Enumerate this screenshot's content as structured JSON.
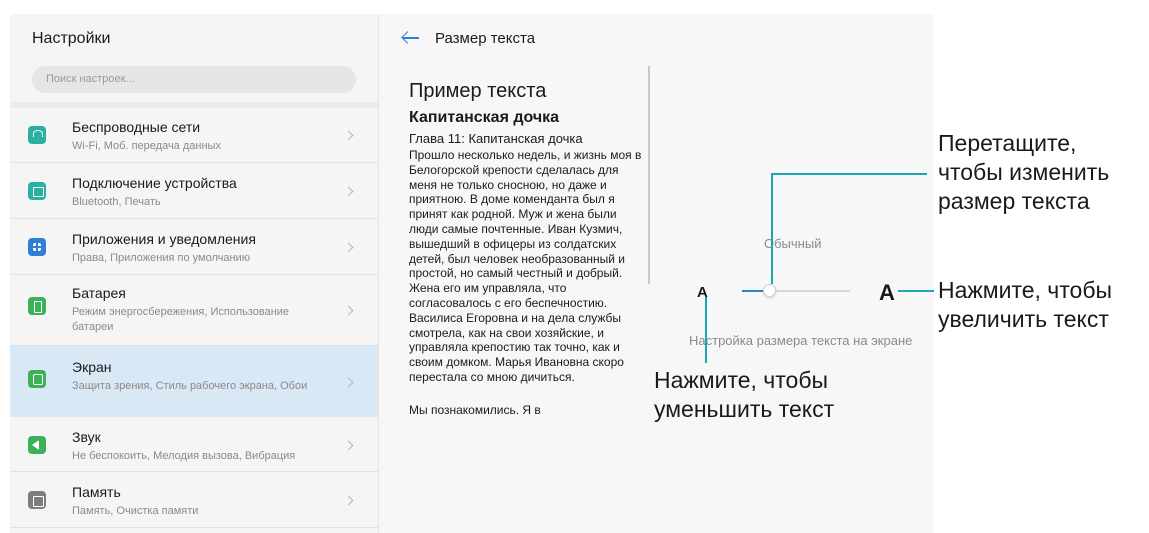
{
  "settings": {
    "title": "Настройки",
    "search_placeholder": "Поиск настроек...",
    "items": [
      {
        "title": "Беспроводные сети",
        "subtitle": "Wi-Fi, Моб. передача данных",
        "icon": "wifi-icon"
      },
      {
        "title": "Подключение устройства",
        "subtitle": "Bluetooth, Печать",
        "icon": "device-connection-icon"
      },
      {
        "title": "Приложения и уведомления",
        "subtitle": "Права, Приложения по умолчанию",
        "icon": "apps-icon"
      },
      {
        "title": "Батарея",
        "subtitle": "Режим энергосбережения, Использование батареи",
        "icon": "battery-icon"
      },
      {
        "title": "Экран",
        "subtitle": "Защита зрения, Стиль рабочего экрана, Обои",
        "icon": "display-icon",
        "selected": true
      },
      {
        "title": "Звук",
        "subtitle": "Не беспокоить, Мелодия вызова, Вибрация",
        "icon": "sound-icon"
      },
      {
        "title": "Память",
        "subtitle": "Память, Очистка памяти",
        "icon": "memory-icon"
      }
    ]
  },
  "detail": {
    "title": "Размер текста",
    "sample": {
      "heading": "Пример текста",
      "book": "Капитанская дочка",
      "chapter": "Глава 11: Капитанская дочка",
      "body": "Прошло несколько недель, и жизнь моя в Белогорской крепости сделалась для меня не только сносною, но даже и приятною. В доме коменданта был я принят как родной. Муж и жена были люди самые почтенные. Иван Кузмич, вышедший в офицеры из солдатских детей, был человек необразованный и простой, но самый честный и добрый. Жена его им управляла, что согласовалось с его беспечностию. Василиса Егоровна и на дела службы смотрела, как на свои хозяйские, и управляла крепостию так точно, как и своим домком. Марья Ивановна скоро перестала со мною дичиться.",
      "next": "Мы познакомились. Я в"
    },
    "size_label": "Обычный",
    "small_glyph": "A",
    "big_glyph": "A",
    "slider_level": 0.2,
    "hint": "Настройка размера текста на экране"
  },
  "callouts": {
    "drag": "Перетащите,\nчтобы изменить\nразмер текста",
    "bigger": "Нажмите, чтобы\nувеличить текст",
    "smaller": "Нажмите, чтобы\nуменьшить текст"
  },
  "colors": {
    "accent": "#2f7fd6",
    "selected_row": "#d9e8f5",
    "callout_line": "#1aa6b2"
  }
}
